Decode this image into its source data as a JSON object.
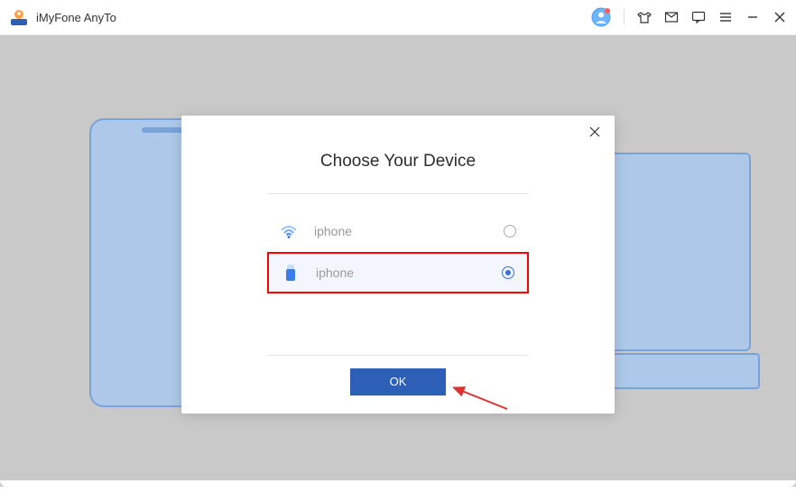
{
  "app": {
    "title": "iMyFone AnyTo"
  },
  "modal": {
    "title": "Choose Your Device",
    "devices": [
      {
        "label": "iphone",
        "connection": "wifi",
        "selected": false
      },
      {
        "label": "iphone",
        "connection": "usb",
        "selected": true
      }
    ],
    "ok_label": "OK"
  },
  "colors": {
    "primary": "#2e5fb7",
    "highlight": "#ff0000",
    "accent": "#3a6fd8"
  }
}
